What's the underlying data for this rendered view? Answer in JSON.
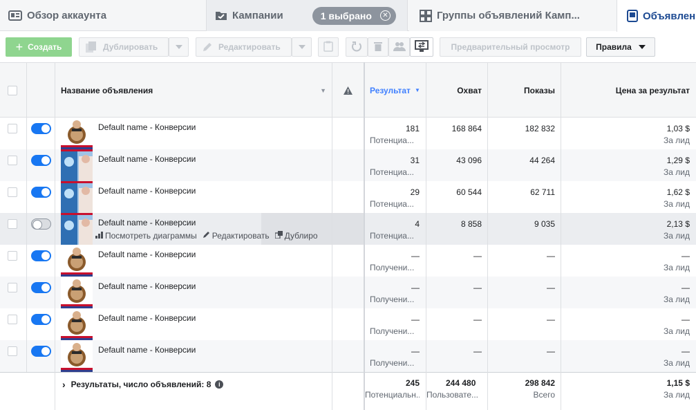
{
  "tabs": {
    "overview": "Обзор аккаунта",
    "campaigns": "Кампании",
    "selected": "1 выбрано",
    "adsets": "Группы объявлений Камп...",
    "ads": "Объявлени"
  },
  "toolbar": {
    "create": "Создать",
    "duplicate": "Дублировать",
    "edit": "Редактировать",
    "preview": "Предварительный просмотр",
    "rules": "Правила"
  },
  "columns": {
    "name": "Название объявления",
    "results": "Результат",
    "reach": "Охват",
    "impressions": "Показы",
    "cost": "Цена за результат"
  },
  "rows": [
    {
      "name": "Default name - Конверсии",
      "on": true,
      "thumb": "person",
      "results": "181",
      "results_sub": "Потенциа...",
      "reach": "168 864",
      "impressions": "182 832",
      "cost": "1,03 $",
      "cost_sub": "За лид"
    },
    {
      "name": "Default name - Конверсии",
      "on": true,
      "thumb": "medical",
      "results": "31",
      "results_sub": "Потенциа...",
      "reach": "43 096",
      "impressions": "44 264",
      "cost": "1,29 $",
      "cost_sub": "За лид"
    },
    {
      "name": "Default name - Конверсии",
      "on": true,
      "thumb": "medical",
      "results": "29",
      "results_sub": "Потенциа...",
      "reach": "60 544",
      "impressions": "62 711",
      "cost": "1,62 $",
      "cost_sub": "За лид"
    },
    {
      "name": "Default name - Конверсии",
      "on": false,
      "thumb": "medical",
      "results": "4",
      "results_sub": "Потенциа...",
      "reach": "8 858",
      "impressions": "9 035",
      "cost": "2,13 $",
      "cost_sub": "За лид"
    },
    {
      "name": "Default name - Конверсии",
      "on": true,
      "thumb": "person",
      "results": "—",
      "results_sub": "Получени...",
      "reach": "—",
      "impressions": "—",
      "cost": "—",
      "cost_sub": "За лид"
    },
    {
      "name": "Default name - Конверсии",
      "on": true,
      "thumb": "person",
      "results": "—",
      "results_sub": "Получени...",
      "reach": "—",
      "impressions": "—",
      "cost": "—",
      "cost_sub": "За лид"
    },
    {
      "name": "Default name - Конверсии",
      "on": true,
      "thumb": "person",
      "results": "—",
      "results_sub": "Получени...",
      "reach": "—",
      "impressions": "—",
      "cost": "—",
      "cost_sub": "За лид"
    },
    {
      "name": "Default name - Конверсии",
      "on": true,
      "thumb": "person",
      "results": "—",
      "results_sub": "Получени...",
      "reach": "—",
      "impressions": "—",
      "cost": "—",
      "cost_sub": "За лид"
    }
  ],
  "hover_actions": {
    "charts": "Посмотреть диаграммы",
    "edit": "Редактировать",
    "duplicate": "Дублиро"
  },
  "footer": {
    "label": "Результаты, число объявлений: 8",
    "results": "245",
    "results_sub": "Потенциальн...",
    "reach": "244 480",
    "reach_sub": "Пользовате...",
    "impressions": "298 842",
    "impressions_sub": "Всего",
    "cost": "1,15 $",
    "cost_sub": "За лид"
  },
  "colors": {
    "accent": "#1877f2",
    "create_button": "#8fd58f",
    "header_bg": "#f5f6f7",
    "active_tab_text": "#1d4a92"
  }
}
